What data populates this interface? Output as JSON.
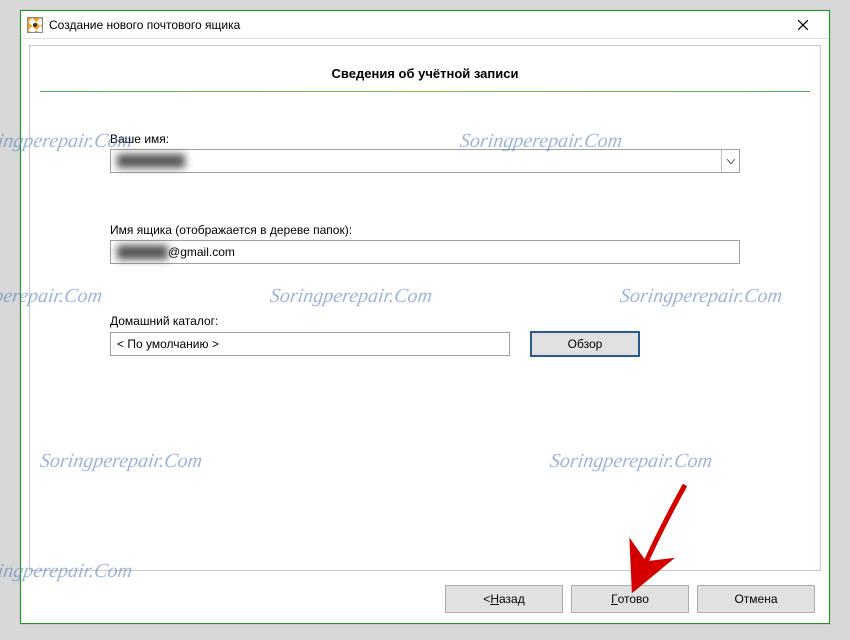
{
  "window": {
    "title": "Создание нового почтового ящика"
  },
  "heading": "Сведения об учётной записи",
  "fields": {
    "name_label": "Ваше имя:",
    "name_value": "████████",
    "mailbox_label": "Имя ящика (отображается в дереве папок):",
    "mailbox_value_hidden": "██████",
    "mailbox_value_suffix": "@gmail.com",
    "home_label": "Домашний каталог:",
    "home_value": "< По умолчанию >",
    "browse_label": "Обзор"
  },
  "buttons": {
    "back_prefix": "<  ",
    "back_key": "Н",
    "back_suffix": "азад",
    "finish_key": "Г",
    "finish_suffix": "отово",
    "cancel_label": "Отмена"
  },
  "watermark": "Soringperepair.Com"
}
